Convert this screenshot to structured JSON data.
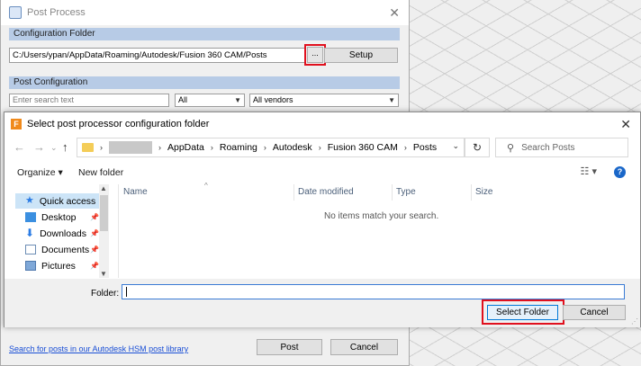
{
  "post_process": {
    "title": "Post Process",
    "close": "✕",
    "configuration_folder_header": "Configuration Folder",
    "folder_path": "C:/Users/ypan/AppData/Roaming/Autodesk/Fusion 360 CAM/Posts",
    "browse_label": "...",
    "setup_label": "Setup",
    "post_configuration_header": "Post Configuration",
    "search_placeholder": "Enter search text",
    "filter_all": "All",
    "vendor_filter": "All vendors",
    "library_link": "Search for posts in our Autodesk HSM post library",
    "post_label": "Post",
    "cancel_label": "Cancel"
  },
  "folder_dialog": {
    "title": "Select post processor configuration folder",
    "close": "✕",
    "breadcrumb": [
      "AppData",
      "Roaming",
      "Autodesk",
      "Fusion 360 CAM",
      "Posts"
    ],
    "search_placeholder": "Search Posts",
    "organize_label": "Organize ▾",
    "new_folder_label": "New folder",
    "help": "?",
    "nav_items": [
      {
        "label": "Quick access"
      },
      {
        "label": "Desktop"
      },
      {
        "label": "Downloads"
      },
      {
        "label": "Documents"
      },
      {
        "label": "Pictures"
      }
    ],
    "columns": [
      "Name",
      "Date modified",
      "Type",
      "Size"
    ],
    "empty_message": "No items match your search.",
    "folder_label": "Folder:",
    "folder_value": "",
    "select_folder_label": "Select Folder",
    "cancel_label": "Cancel"
  },
  "colors": {
    "highlight": "#e0101e",
    "section_header": "#b7cbe6",
    "selection": "#cce4f7"
  }
}
